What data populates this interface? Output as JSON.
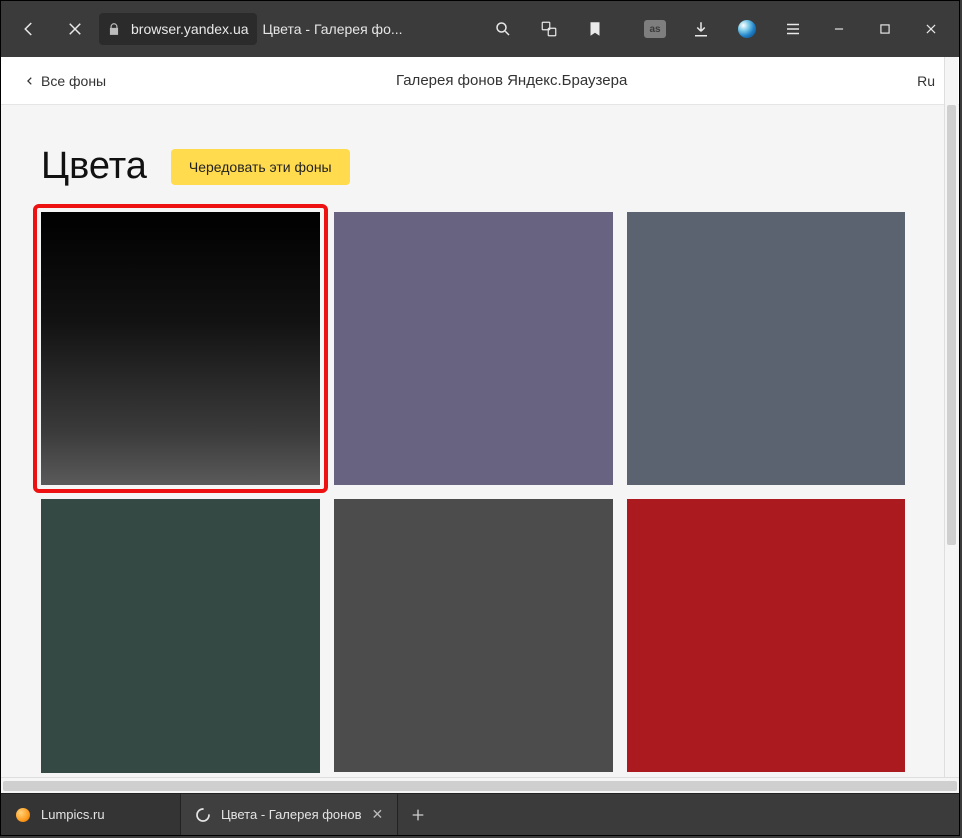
{
  "toolbar": {
    "url": "browser.yandex.ua",
    "tab_title": "Цвета - Галерея фо...",
    "ext_label": "as"
  },
  "header": {
    "back_label": "Все фоны",
    "title": "Галерея фонов Яндекс.Браузера",
    "lang": "Ru"
  },
  "page": {
    "title": "Цвета",
    "shuffle_label": "Чередовать эти фоны"
  },
  "tiles": [
    {
      "name": "black-gradient",
      "color": "linear",
      "highlighted": true
    },
    {
      "name": "purple-grey",
      "color": "#676381",
      "highlighted": false
    },
    {
      "name": "slate-blue",
      "color": "#5a636f",
      "highlighted": false
    },
    {
      "name": "dark-green",
      "color": "#344944",
      "highlighted": false
    },
    {
      "name": "dark-grey",
      "color": "#4c4c4c",
      "highlighted": false
    },
    {
      "name": "crimson",
      "color": "#aa1a1f",
      "highlighted": false
    }
  ],
  "tabs": [
    {
      "label": "Lumpics.ru",
      "active": false,
      "icon": "orange"
    },
    {
      "label": "Цвета - Галерея фонов",
      "active": true,
      "icon": "loading"
    }
  ]
}
